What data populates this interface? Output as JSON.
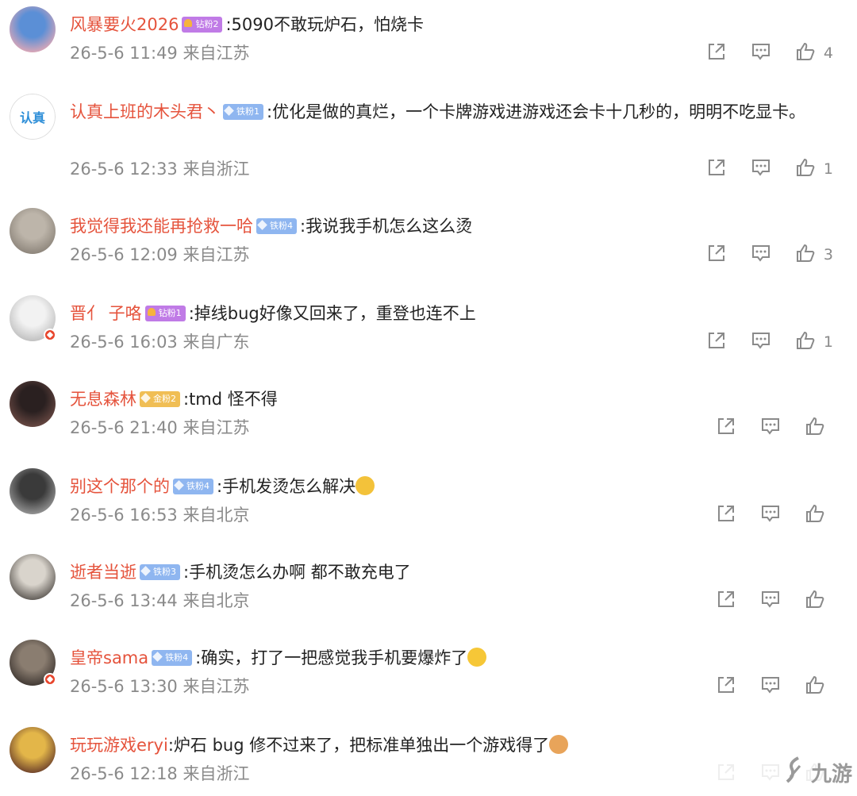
{
  "comments": [
    {
      "user": "风暴要火2026",
      "badge": "钻粉2",
      "badge_color": "#c07be6",
      "badge_kind": "crown",
      "text": ":5090不敢玩炉石，怕烧卡",
      "time": "26-5-6 11:49 来自江苏",
      "likes": "4",
      "avatar_colors": [
        "#5b8fd6",
        "#e3a8b5"
      ]
    },
    {
      "user": "认真上班的木头君丶",
      "badge": "铁粉1",
      "badge_color": "#8fb6f0",
      "badge_kind": "gem",
      "text": ":优化是做的真烂，一个卡牌游戏进游戏还会卡十几秒的，明明不吃显卡。",
      "time": "26-5-6 12:33 来自浙江",
      "likes": "1",
      "avatar_colors": [
        "#ffffff",
        "#2f8fd8"
      ],
      "avatar_text": "认真"
    },
    {
      "user": "我觉得我还能再抢救一哈",
      "badge": "铁粉4",
      "badge_color": "#8fb6f0",
      "badge_kind": "gem",
      "text": ":我说我手机怎么这么烫",
      "time": "26-5-6 12:09 来自江苏",
      "likes": "3",
      "avatar_colors": [
        "#bdb5aa",
        "#8a8278"
      ]
    },
    {
      "user": "晋亻 子咯",
      "badge": "钻粉1",
      "badge_color": "#c07be6",
      "badge_kind": "crown",
      "text": ":掉线bug好像又回来了，重登也连不上",
      "time": "26-5-6 16:03 来自广东",
      "likes": "1",
      "avatar_colors": [
        "#f2f2f2",
        "#bdbdbd"
      ]
    },
    {
      "user": "无息森林",
      "badge": "金粉2",
      "badge_color": "#f0be55",
      "badge_kind": "gem",
      "text": ":tmd 怪不得",
      "time": "26-5-6 21:40 来自江苏",
      "likes": "",
      "avatar_colors": [
        "#2a2020",
        "#6b4a44"
      ]
    },
    {
      "user": "别这个那个的",
      "badge": "铁粉4",
      "badge_color": "#8fb6f0",
      "badge_kind": "gem",
      "text": ":手机发烫怎么解决",
      "time": "26-5-6 16:53 来自北京",
      "likes": "",
      "avatar_colors": [
        "#3a3a3a",
        "#9a9a9a"
      ],
      "emoji_color": "#f3c23a"
    },
    {
      "user": "逝者当逝",
      "badge": "铁粉3",
      "badge_color": "#8fb6f0",
      "badge_kind": "gem",
      "text": ":手机烫怎么办啊  都不敢充电了",
      "time": "26-5-6 13:44 来自北京",
      "likes": "",
      "avatar_colors": [
        "#d9d4cc",
        "#5a5550"
      ]
    },
    {
      "user": "皇帝sama",
      "badge": "铁粉4",
      "badge_color": "#8fb6f0",
      "badge_kind": "gem",
      "text": ":确实，打了一把感觉我手机要爆炸了",
      "time": "26-5-6 13:30 来自江苏",
      "likes": "",
      "avatar_colors": [
        "#8a7d70",
        "#3d3530"
      ],
      "emoji_color": "#f6c737"
    },
    {
      "user": "玩玩游戏eryi",
      "badge": "",
      "badge_color": "",
      "badge_kind": "",
      "text": ":炉石 bug 修不过来了，把标准单独出一个游戏得了",
      "time": "26-5-6 12:18 来自浙江",
      "likes": "",
      "avatar_colors": [
        "#e3b649",
        "#6a3e2a"
      ],
      "emoji_color": "#e8a45a"
    }
  ],
  "watermark": "九游"
}
